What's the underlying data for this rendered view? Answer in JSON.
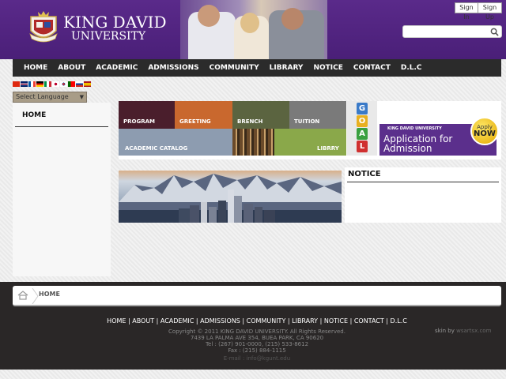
{
  "header": {
    "logo_line1": "KING DAVID",
    "logo_line2": "UNIVERSITY",
    "sign_in": "Sign In",
    "sign_up": "Sign Up",
    "search_placeholder": ""
  },
  "nav": {
    "items": [
      "HOME",
      "ABOUT",
      "ACADEMIC",
      "ADMISSIONS",
      "COMMUNITY",
      "LIBRARY",
      "NOTICE",
      "CONTACT",
      "D.L.C"
    ]
  },
  "language": {
    "select_label": "Select Language",
    "flags": [
      "cn",
      "uk",
      "fr",
      "de",
      "it",
      "jp",
      "kr",
      "pt",
      "ru",
      "es"
    ]
  },
  "sidebar": {
    "title": "HOME"
  },
  "banner": {
    "tiles": [
      "PROGRAM",
      "GREETING",
      "BRENCH",
      "TUITION",
      "ACADEMIC CATALOG",
      "LIBRRY"
    ],
    "goal_letters": [
      "G",
      "O",
      "A",
      "L"
    ],
    "admission_small": "KING DAVID UNIVERSITY",
    "admission_line1": "Application for",
    "admission_line2": "Admission",
    "apply_label": "Apply",
    "apply_now": "NOW"
  },
  "notice": {
    "title": "NOTICE"
  },
  "breadcrumb": {
    "current": "HOME"
  },
  "footer": {
    "links": [
      "HOME",
      "ABOUT",
      "ACADEMIC",
      "ADMISSIONS",
      "COMMUNITY",
      "LIBRARY",
      "NOTICE",
      "CONTACT",
      "D.L.C"
    ],
    "copyright": "Copyright © 2011 KING DAVID UNIVERSITY. All Rights Reserved.",
    "address": "7439 LA PALMA AVE 354, BUEA PARK, CA 90620",
    "tel": "Tel : (267) 901-0000, (215) 533-8612",
    "fax": "Fax : (215) 884-1115",
    "email": "E-mail : info@kgunt.edu",
    "skin_prefix": "skin by",
    "skin_brand": "wsartsx.com"
  },
  "colors": {
    "header_purple": "#4e2080",
    "nav_bg": "#2b2b2b",
    "footer_bg": "#2a2727",
    "admission_purple": "#5b2f8c",
    "apply_gold": "#f0c000"
  }
}
